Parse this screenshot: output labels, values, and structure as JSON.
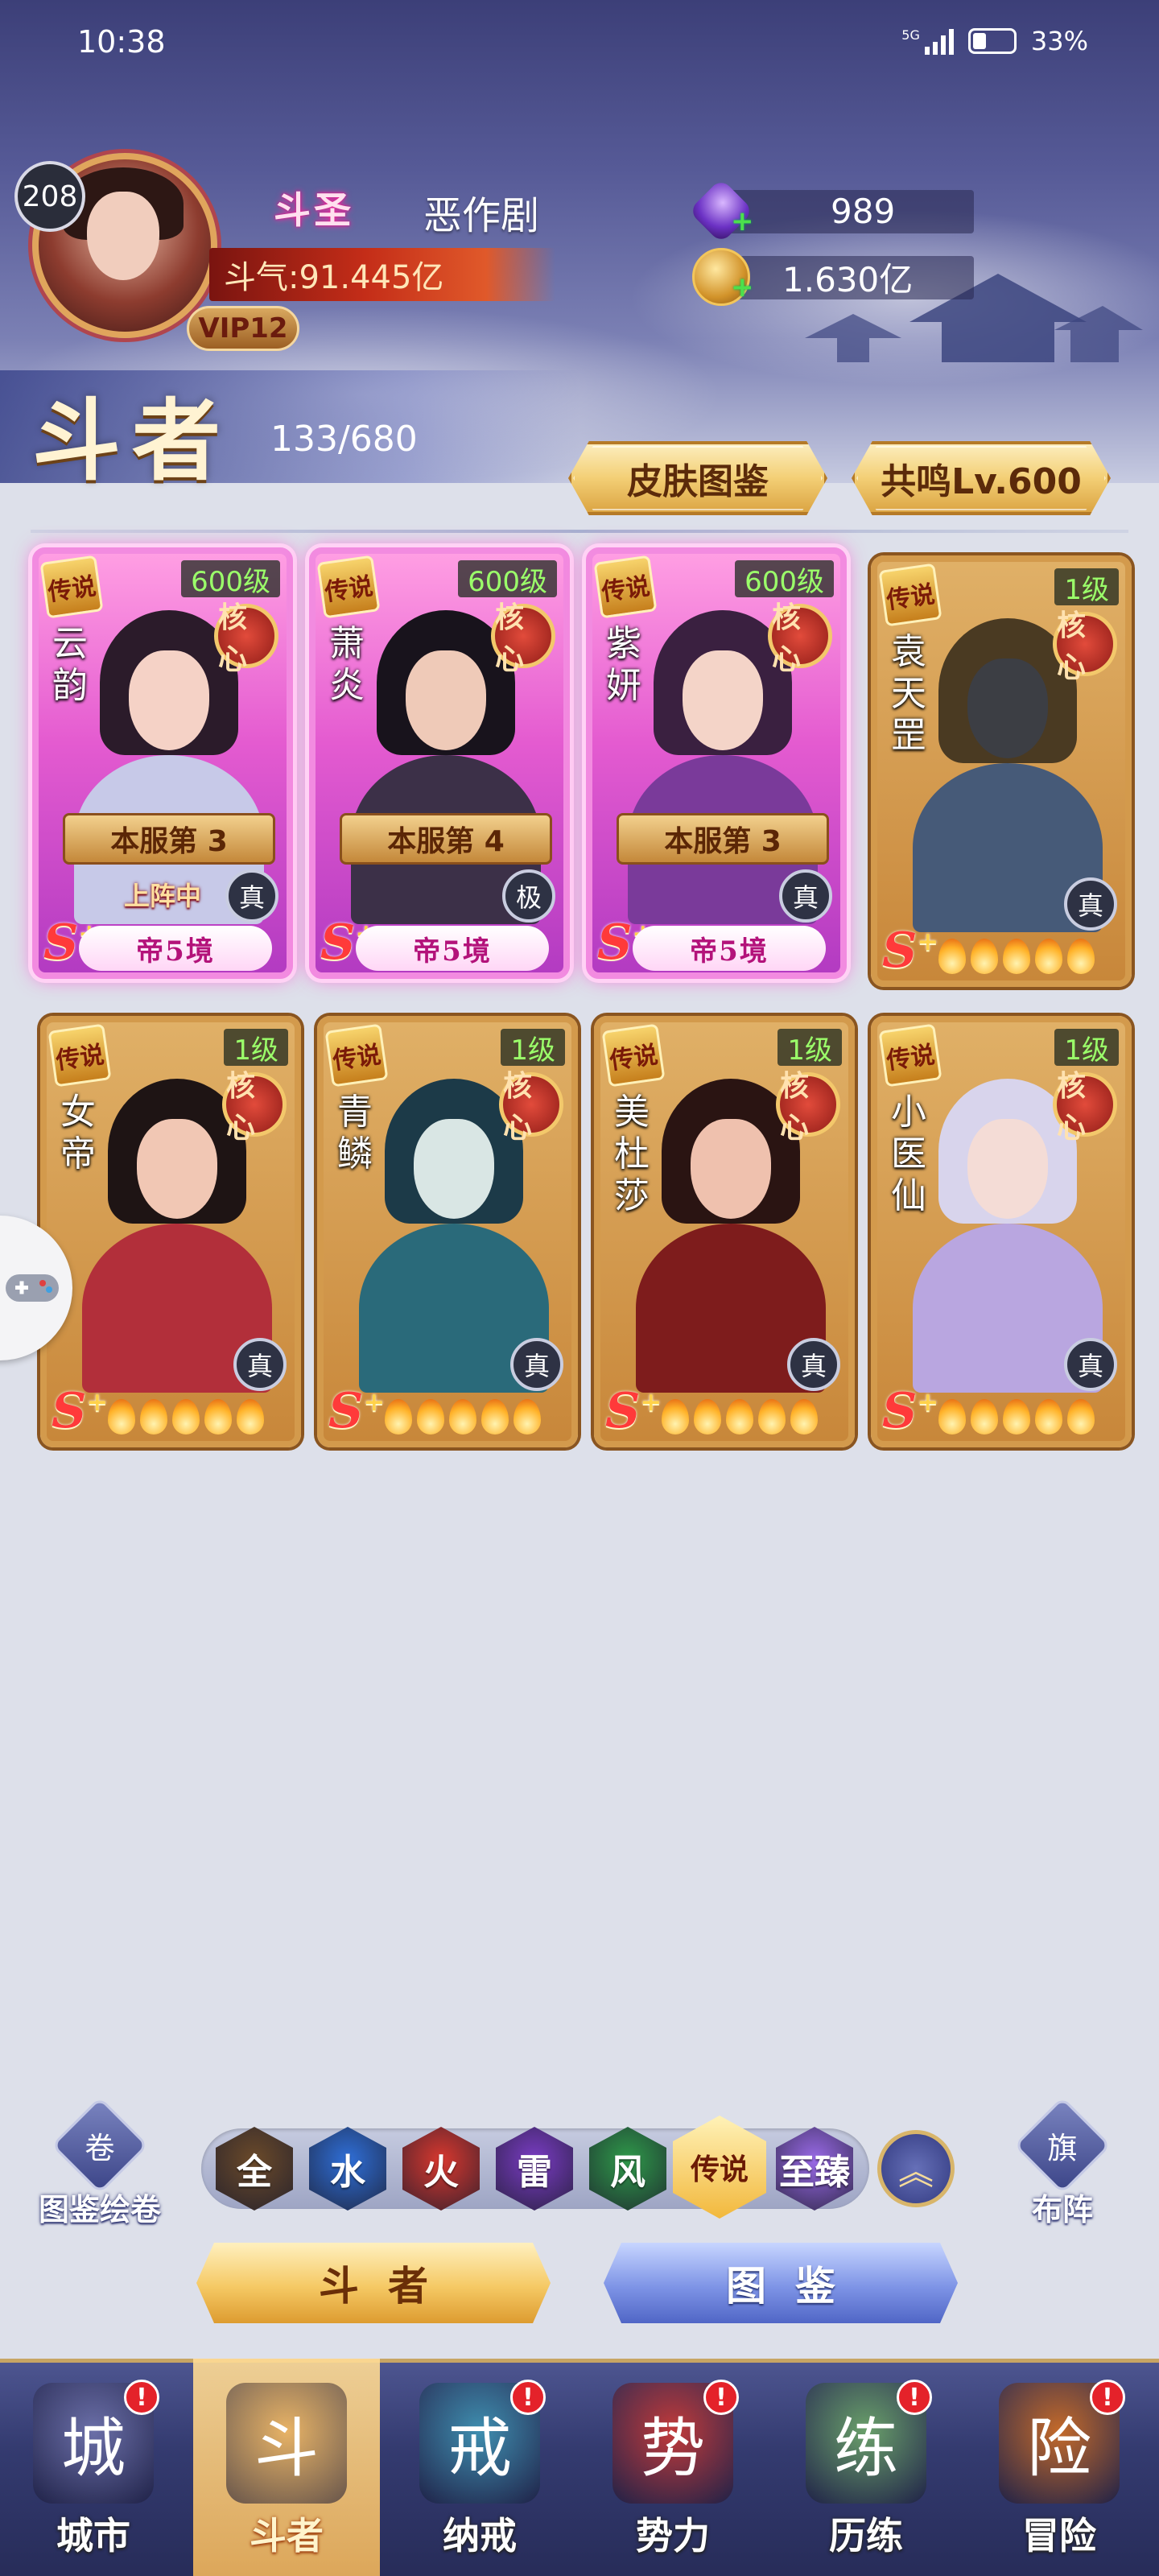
{
  "status_bar": {
    "time": "10:38",
    "network": "5G",
    "battery": "33%"
  },
  "player": {
    "level": "208",
    "rank_title": "斗圣",
    "name": "恶作剧",
    "power": "斗气:91.445亿",
    "vip": "VIP12"
  },
  "resources": [
    {
      "icon": "crystal-icon",
      "value": "989"
    },
    {
      "icon": "gold-coin-icon",
      "value": "1.630亿"
    }
  ],
  "section": {
    "title": "斗者",
    "count": "133/680",
    "skin_button": "皮肤图鉴",
    "resonance_button": "共鸣Lv.600"
  },
  "heroes": [
    {
      "name": "云韵",
      "level": "600级",
      "legend": "传说",
      "core": "核心",
      "style": "pink",
      "rank": "本服第 3",
      "deploy": "上阵中",
      "quality": "真",
      "realm": "帝5境",
      "s_grade": "S",
      "s_plus": "+"
    },
    {
      "name": "萧炎",
      "level": "600级",
      "legend": "传说",
      "core": "核心",
      "style": "pink",
      "rank": "本服第 4",
      "deploy": "",
      "quality": "极",
      "realm": "帝5境",
      "s_grade": "S",
      "s_plus": "+"
    },
    {
      "name": "紫妍",
      "level": "600级",
      "legend": "传说",
      "core": "核心",
      "style": "pink",
      "rank": "本服第 3",
      "deploy": "",
      "quality": "真",
      "realm": "帝5境",
      "s_grade": "S",
      "s_plus": "+"
    },
    {
      "name": "袁天罡",
      "level": "1级",
      "legend": "传说",
      "core": "核心",
      "style": "gold",
      "rank": "",
      "deploy": "",
      "quality": "真",
      "realm": "",
      "s_grade": "S",
      "s_plus": "+"
    },
    {
      "name": "女帝",
      "level": "1级",
      "legend": "传说",
      "core": "核心",
      "style": "gold",
      "rank": "",
      "deploy": "",
      "quality": "真",
      "realm": "",
      "s_grade": "S",
      "s_plus": "+"
    },
    {
      "name": "青鳞",
      "level": "1级",
      "legend": "传说",
      "core": "核心",
      "style": "gold",
      "rank": "",
      "deploy": "",
      "quality": "真",
      "realm": "",
      "s_grade": "S",
      "s_plus": "+"
    },
    {
      "name": "美杜莎",
      "level": "1级",
      "legend": "传说",
      "core": "核心",
      "style": "gold",
      "rank": "",
      "deploy": "",
      "quality": "真",
      "realm": "",
      "s_grade": "S",
      "s_plus": "+"
    },
    {
      "name": "小医仙",
      "level": "1级",
      "legend": "传说",
      "core": "核心",
      "style": "gold",
      "rank": "",
      "deploy": "",
      "quality": "真",
      "realm": "",
      "s_grade": "S",
      "s_plus": "+"
    }
  ],
  "filters": [
    {
      "label": "全",
      "color": "#6b4a2a"
    },
    {
      "label": "水",
      "color": "#2f6fd8"
    },
    {
      "label": "火",
      "color": "#d8382f"
    },
    {
      "label": "雷",
      "color": "#7a3cc4"
    },
    {
      "label": "风",
      "color": "#2f9a4a"
    },
    {
      "label": "传说",
      "color": "#f2b83c",
      "active": true
    },
    {
      "label": "至臻",
      "color": "#9a6ae8"
    }
  ],
  "side_buttons": {
    "left": "图鉴绘卷",
    "right": "布阵"
  },
  "actions": {
    "fighters": "斗者",
    "codex": "图鉴"
  },
  "nav": [
    {
      "label": "城市",
      "icon": "city-icon",
      "badge": "!"
    },
    {
      "label": "斗者",
      "icon": "fighter-icon",
      "badge": "",
      "active": true
    },
    {
      "label": "纳戒",
      "icon": "ring-icon",
      "badge": "!"
    },
    {
      "label": "势力",
      "icon": "faction-icon",
      "badge": "!"
    },
    {
      "label": "历练",
      "icon": "training-icon",
      "badge": "!"
    },
    {
      "label": "冒险",
      "icon": "adventure-icon",
      "badge": "!"
    }
  ]
}
